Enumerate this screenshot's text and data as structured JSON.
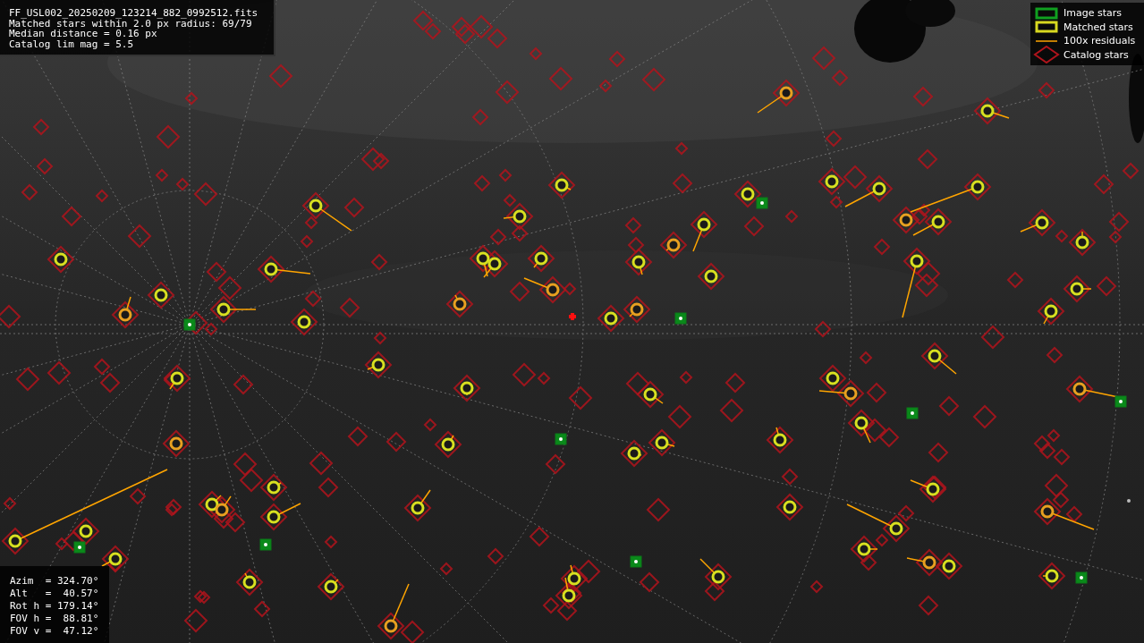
{
  "info_panel": {
    "lines": [
      "FF_USL002_20250209_123214_882_0992512.fits",
      "Matched stars within 2.0 px radius: 69/79",
      "Median distance = 0.16 px",
      "Catalog lim mag = 5.5"
    ]
  },
  "legend": [
    {
      "label": "Image stars"
    },
    {
      "kind": "matched",
      "label": "Matched stars"
    },
    {
      "kind": "residual",
      "label": "100x residuals"
    },
    {
      "kind": "catalog",
      "label": "Catalog stars"
    }
  ],
  "pointing_panel": {
    "lines": [
      "Azim  = 324.70°",
      "Alt   =  40.57°",
      "Rot h = 179.14°",
      "FOV h =  88.81°",
      "FOV v =  47.12°"
    ]
  }
}
